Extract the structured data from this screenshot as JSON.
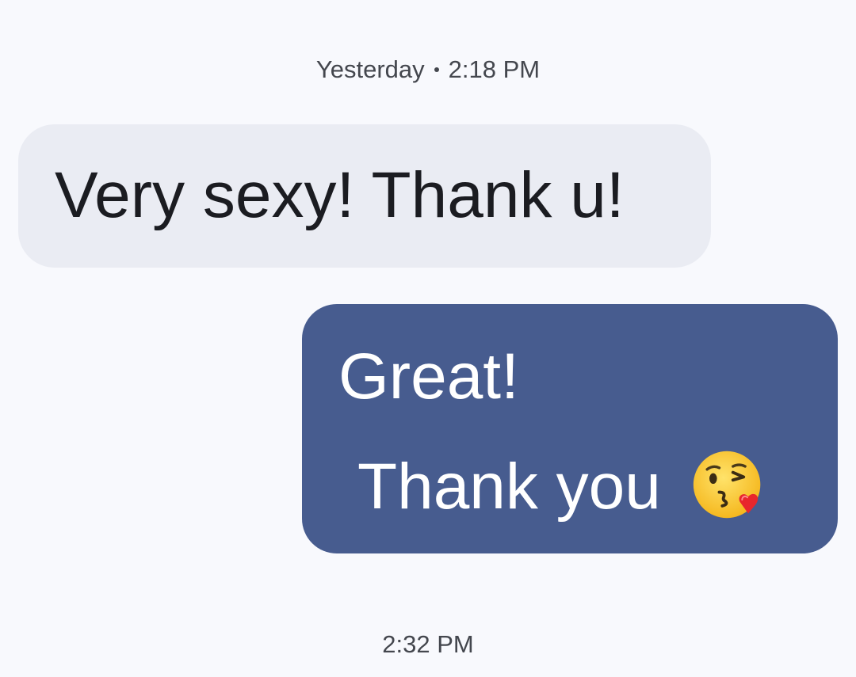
{
  "thread": {
    "top_timestamp": {
      "day": "Yesterday",
      "time": "2:18 PM"
    },
    "messages": [
      {
        "direction": "incoming",
        "text": "Very sexy! Thank u!"
      },
      {
        "direction": "outgoing",
        "lines": [
          "Great!",
          "Thank you"
        ],
        "emoji": "face-blowing-a-kiss-icon"
      }
    ],
    "bottom_timestamp": "2:32 PM"
  },
  "colors": {
    "background": "#f8f9fd",
    "incoming_bubble": "#eaecf3",
    "outgoing_bubble": "#475c8f",
    "incoming_text": "#1b1c21",
    "outgoing_text": "#ffffff",
    "timestamp_text": "#44474e"
  }
}
